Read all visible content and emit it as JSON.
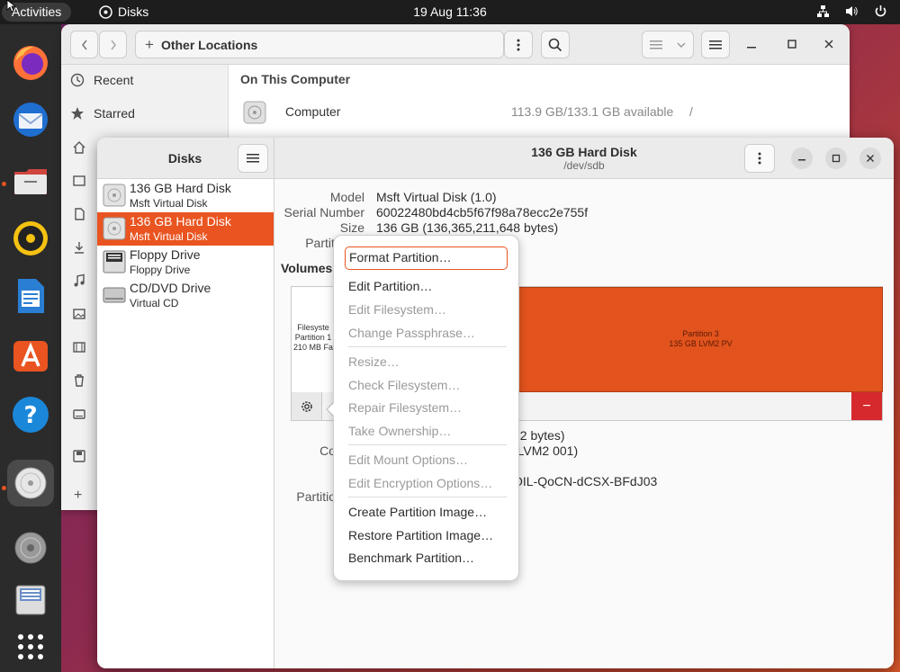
{
  "topbar": {
    "activities": "Activities",
    "app_name": "Disks",
    "clock": "19 Aug  11:36"
  },
  "files_window": {
    "location": "Other Locations",
    "sidebar": [
      {
        "label": "Recent",
        "icon": "clock-icon"
      },
      {
        "label": "Starred",
        "icon": "star-icon"
      }
    ],
    "section_title": "On This Computer",
    "row": {
      "name": "Computer",
      "space": "113.9 GB/133.1 GB available",
      "path": "/"
    }
  },
  "disks_window": {
    "sidebar_title": "Disks",
    "title": "136 GB Hard Disk",
    "subtitle": "/dev/sdb",
    "drives": [
      {
        "name": "136 GB Hard Disk",
        "sub": "Msft Virtual Disk"
      },
      {
        "name": "136 GB Hard Disk",
        "sub": "Msft Virtual Disk"
      },
      {
        "name": "Floppy Drive",
        "sub": "Floppy Drive"
      },
      {
        "name": "CD/DVD Drive",
        "sub": "Virtual CD"
      }
    ],
    "info": {
      "model_label": "Model",
      "model": "Msft Virtual Disk (1.0)",
      "serial_label": "Serial Number",
      "serial": "60022480bd4cb5f67f98a78ecc2e755f",
      "size_label": "Size",
      "size": "136 GB (136,365,211,648 bytes)",
      "partitioning_label": "Partiti"
    },
    "volumes_label": "Volumes",
    "partition1": [
      "Filesyste",
      "Partition 1",
      "210 MB Fa"
    ],
    "partition3": [
      "Partition 3",
      "135 GB LVM2 PV"
    ],
    "detail": {
      "size_frag": "72 bytes)",
      "contents_label": "Co",
      "contents_frag": "(LVM2 001)",
      "uuid_frag": "OIL-QoCN-dCSX-BFdJ03",
      "partition_label": "Partitio"
    },
    "minus_label": "−"
  },
  "context_menu": {
    "items": [
      {
        "label": "Format Partition…",
        "enabled": true
      },
      {
        "label": "Edit Partition…",
        "enabled": true
      },
      {
        "label": "Edit Filesystem…",
        "enabled": false
      },
      {
        "label": "Change Passphrase…",
        "enabled": false
      },
      {
        "label": "Resize…",
        "enabled": false
      },
      {
        "label": "Check Filesystem…",
        "enabled": false
      },
      {
        "label": "Repair Filesystem…",
        "enabled": false
      },
      {
        "label": "Take Ownership…",
        "enabled": false
      },
      {
        "label": "Edit Mount Options…",
        "enabled": false
      },
      {
        "label": "Edit Encryption Options…",
        "enabled": false
      },
      {
        "label": "Create Partition Image…",
        "enabled": true
      },
      {
        "label": "Restore Partition Image…",
        "enabled": true
      },
      {
        "label": "Benchmark Partition…",
        "enabled": true
      }
    ]
  },
  "colors": {
    "accent": "#e95420",
    "partition_fill": "#e2531d",
    "dock": "#2b2b2b"
  }
}
